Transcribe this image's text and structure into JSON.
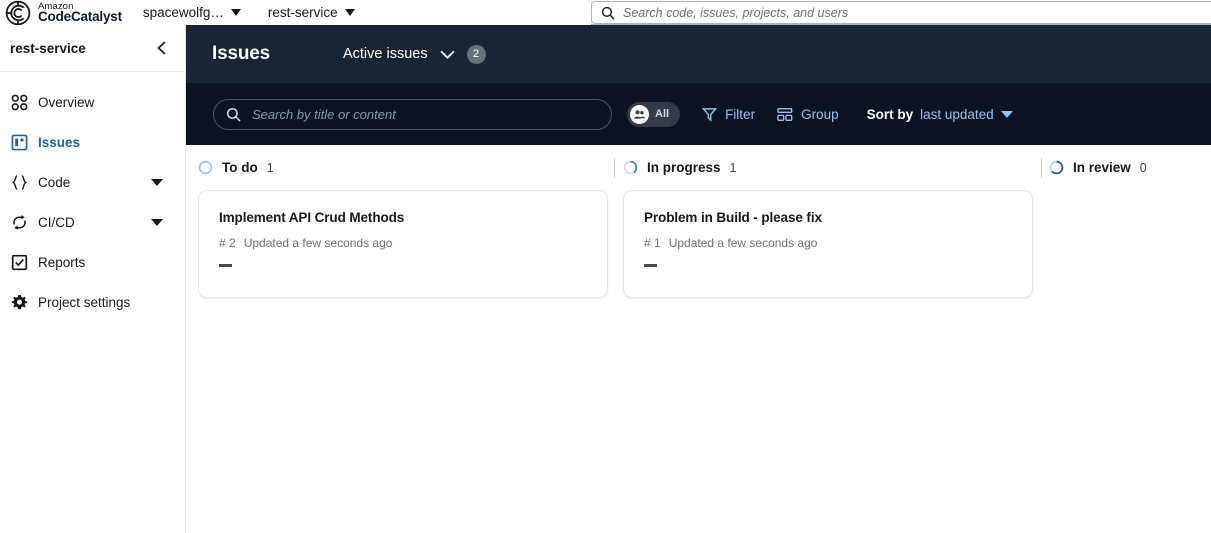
{
  "topbar": {
    "brand_line1": "Amazon",
    "brand_line2": "CodeCatalyst",
    "logo_icon": "codecatalyst-logo-icon",
    "space_label": "spacewolfg…",
    "project_label": "rest-service",
    "space_caret_icon": "caret-down-icon",
    "project_caret_icon": "caret-down-icon"
  },
  "global_search": {
    "icon": "search-icon",
    "placeholder": "Search code, issues, projects, and users",
    "value": ""
  },
  "sidebar": {
    "title": "rest-service",
    "collapse_icon": "chevron-left-icon",
    "items": [
      {
        "label": "Overview",
        "icon": "grid-dots-icon",
        "active": false,
        "expandable": false
      },
      {
        "label": "Issues",
        "icon": "issues-board-icon",
        "active": true,
        "expandable": false
      },
      {
        "label": "Code",
        "icon": "curly-braces-icon",
        "active": false,
        "expandable": true
      },
      {
        "label": "CI/CD",
        "icon": "cycle-arrows-icon",
        "active": false,
        "expandable": true
      },
      {
        "label": "Reports",
        "icon": "checkbox-square-icon",
        "active": false,
        "expandable": false
      },
      {
        "label": "Project settings",
        "icon": "gear-icon",
        "active": false,
        "expandable": false
      }
    ]
  },
  "issues_header": {
    "title": "Issues",
    "view_label": "Active issues",
    "view_caret_icon": "chevron-down-icon",
    "view_count": "2"
  },
  "toolbar": {
    "search_icon": "search-icon",
    "search_placeholder": "Search by title or content",
    "search_value": "",
    "assignee_pill": {
      "icon": "people-icon",
      "label": "All"
    },
    "filter": {
      "icon": "funnel-icon",
      "label": "Filter"
    },
    "group": {
      "icon": "group-grid-icon",
      "label": "Group"
    },
    "sort": {
      "static_label": "Sort by",
      "value": "last updated",
      "caret_icon": "caret-down-icon"
    }
  },
  "board": {
    "columns": [
      {
        "name": "To do",
        "count": "1",
        "status_icon": "circle-empty-icon",
        "icon_color": "#9ec6e3",
        "cards": [
          {
            "title": "Implement API Crud Methods",
            "number": "# 2",
            "updated": "Updated a few seconds ago",
            "assignee": "—"
          }
        ]
      },
      {
        "name": "In progress",
        "count": "1",
        "status_icon": "circle-progress-icon",
        "icon_color": "#5b9bd1",
        "cards": [
          {
            "title": "Problem in Build - please fix",
            "number": "# 1",
            "updated": "Updated a few seconds ago",
            "assignee": "—"
          }
        ]
      },
      {
        "name": "In review",
        "count": "0",
        "status_icon": "circle-review-icon",
        "icon_color": "#1c5f96",
        "cards": []
      }
    ]
  },
  "colors": {
    "header_dark": "#192534",
    "toolbar_dark": "#0b1420",
    "link_blue": "#93c1ec",
    "active_blue": "#246595"
  }
}
